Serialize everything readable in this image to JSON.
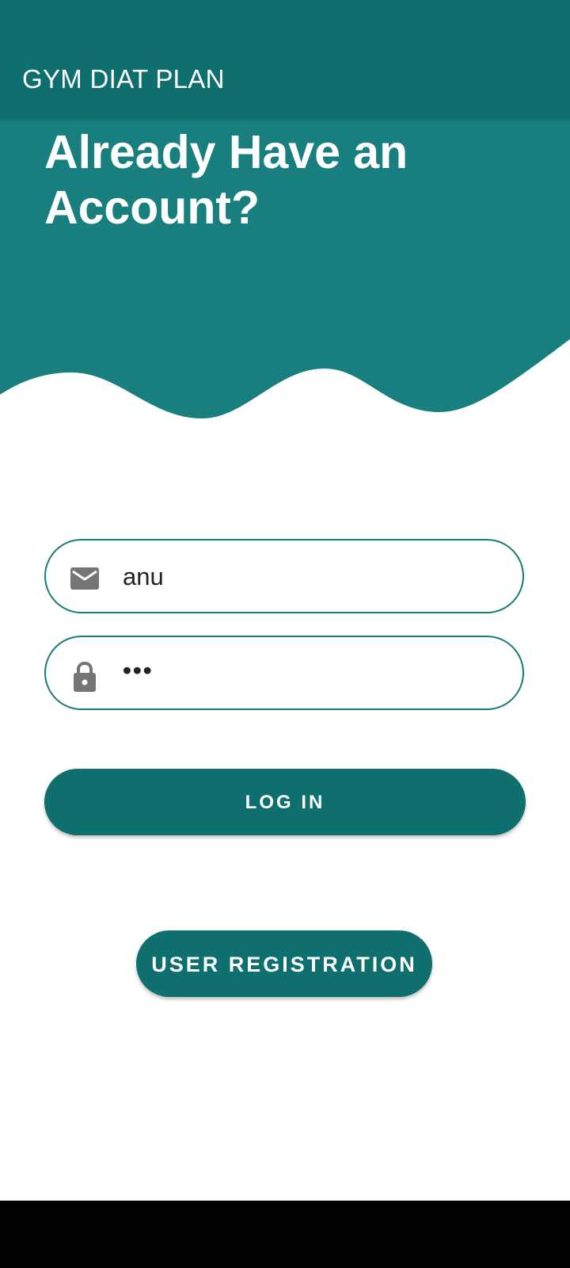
{
  "app_bar": {
    "title": "GYM DIAT PLAN"
  },
  "header": {
    "heading": "Already Have an Account?"
  },
  "form": {
    "email": {
      "icon": "email-icon",
      "value": "anu"
    },
    "password": {
      "icon": "lock-icon",
      "value": "•••"
    }
  },
  "buttons": {
    "login_label": "LOG IN",
    "register_label": "USER REGISTRATION"
  },
  "colors": {
    "app_bar": "#0e6f6e",
    "header": "#187f7e",
    "field_border": "#157b7a",
    "icon": "#757575"
  }
}
